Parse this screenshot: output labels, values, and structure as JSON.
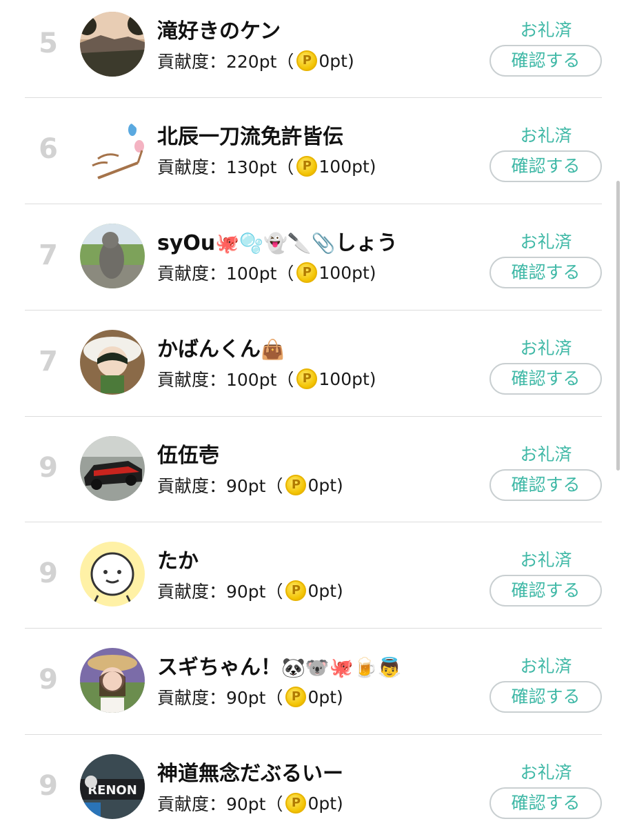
{
  "entries": [
    {
      "rank": "5",
      "name": "滝好きのケン",
      "name_emoji": "",
      "contribution_prefix": "貢献度：220pt（",
      "coin_letter": "P",
      "points": "0pt)",
      "status": "お礼済",
      "button": "確認する"
    },
    {
      "rank": "6",
      "name": "北辰一刀流免許皆伝",
      "name_emoji": "",
      "contribution_prefix": "貢献度：130pt（",
      "coin_letter": "P",
      "points": "100pt)",
      "status": "お礼済",
      "button": "確認する"
    },
    {
      "rank": "7",
      "name": "syOu",
      "name_emoji": "🐙🫧👻🔪📎",
      "name_suffix": "しょう",
      "contribution_prefix": "貢献度：100pt（",
      "coin_letter": "P",
      "points": "100pt)",
      "status": "お礼済",
      "button": "確認する"
    },
    {
      "rank": "7",
      "name": "かばんくん",
      "name_emoji": "👜",
      "contribution_prefix": "貢献度：100pt（",
      "coin_letter": "P",
      "points": "100pt)",
      "status": "お礼済",
      "button": "確認する"
    },
    {
      "rank": "9",
      "name": "伍伍壱",
      "name_emoji": "",
      "contribution_prefix": "貢献度：90pt（",
      "coin_letter": "P",
      "points": "0pt)",
      "status": "お礼済",
      "button": "確認する"
    },
    {
      "rank": "9",
      "name": "たか",
      "name_emoji": "",
      "contribution_prefix": "貢献度：90pt（",
      "coin_letter": "P",
      "points": "0pt)",
      "status": "お礼済",
      "button": "確認する"
    },
    {
      "rank": "9",
      "name": "スギちゃん！",
      "name_emoji": "🐼🐨🐙🍺👼",
      "contribution_prefix": "貢献度：90pt（",
      "coin_letter": "P",
      "points": "0pt)",
      "status": "お礼済",
      "button": "確認する"
    },
    {
      "rank": "9",
      "name": "神道無念だぶるいー",
      "name_emoji": "",
      "contribution_prefix": "貢献度：90pt（",
      "coin_letter": "P",
      "points": "0pt)",
      "status": "お礼済",
      "button": "確認する"
    }
  ],
  "avatar_graphic": {
    "text": "RENON"
  },
  "colors": {
    "accent": "#3fb8a6",
    "rank": "#d2d2d2",
    "coin": "#f2c200",
    "border": "#c9cfd1"
  }
}
